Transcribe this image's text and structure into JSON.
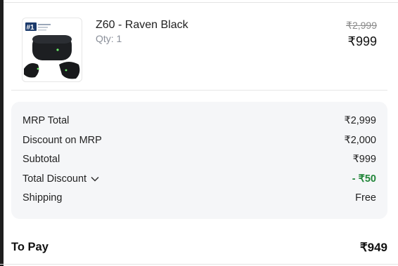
{
  "product": {
    "name": "Z60 - Raven Black",
    "qty": "Qty: 1",
    "mrp": "₹2,999",
    "price": "₹999",
    "badge": "#1",
    "image_icon": "earbuds-case-icon"
  },
  "summary": {
    "rows": [
      {
        "label": "MRP Total",
        "value": "₹2,999"
      },
      {
        "label": "Discount on MRP",
        "value": "₹2,000"
      },
      {
        "label": "Subtotal",
        "value": "₹999"
      },
      {
        "label": "Total Discount",
        "value": "- ₹50"
      },
      {
        "label": "Shipping",
        "value": "Free"
      }
    ]
  },
  "to_pay": {
    "label": "To Pay",
    "value": "₹949"
  },
  "colors": {
    "discount_green": "#22863a",
    "summary_bg": "#f5f6f8"
  }
}
